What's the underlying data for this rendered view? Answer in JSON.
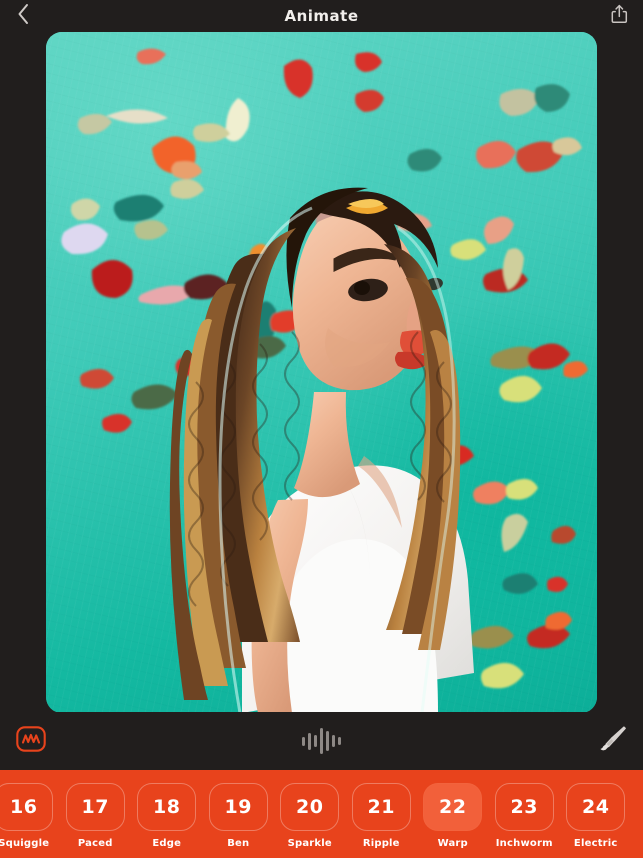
{
  "header": {
    "title": "Animate",
    "back_icon": "chevron-left-icon",
    "share_icon": "share-icon"
  },
  "canvas": {
    "artwork_description": "Stylized painted portrait of a woman with long curly hair in a white top against a teal background with colorful confetti shapes",
    "background_color": "#2ec4b0"
  },
  "toolbar": {
    "left_icon": "squiggle-icon",
    "center_icon": "waveform-icon",
    "right_icon": "paintbrush-icon",
    "accent_color": "#e8431c"
  },
  "styles": {
    "strip_color": "#e8431c",
    "selected_color": "#f2603a",
    "selected_index": 6,
    "items": [
      {
        "number": "16",
        "label": "Squiggle",
        "selected": false
      },
      {
        "number": "17",
        "label": "Paced",
        "selected": false
      },
      {
        "number": "18",
        "label": "Edge",
        "selected": false
      },
      {
        "number": "19",
        "label": "Ben",
        "selected": false
      },
      {
        "number": "20",
        "label": "Sparkle",
        "selected": false
      },
      {
        "number": "21",
        "label": "Ripple",
        "selected": false
      },
      {
        "number": "22",
        "label": "Warp",
        "selected": true
      },
      {
        "number": "23",
        "label": "Inchworm",
        "selected": false
      },
      {
        "number": "24",
        "label": "Electric",
        "selected": false
      }
    ]
  }
}
